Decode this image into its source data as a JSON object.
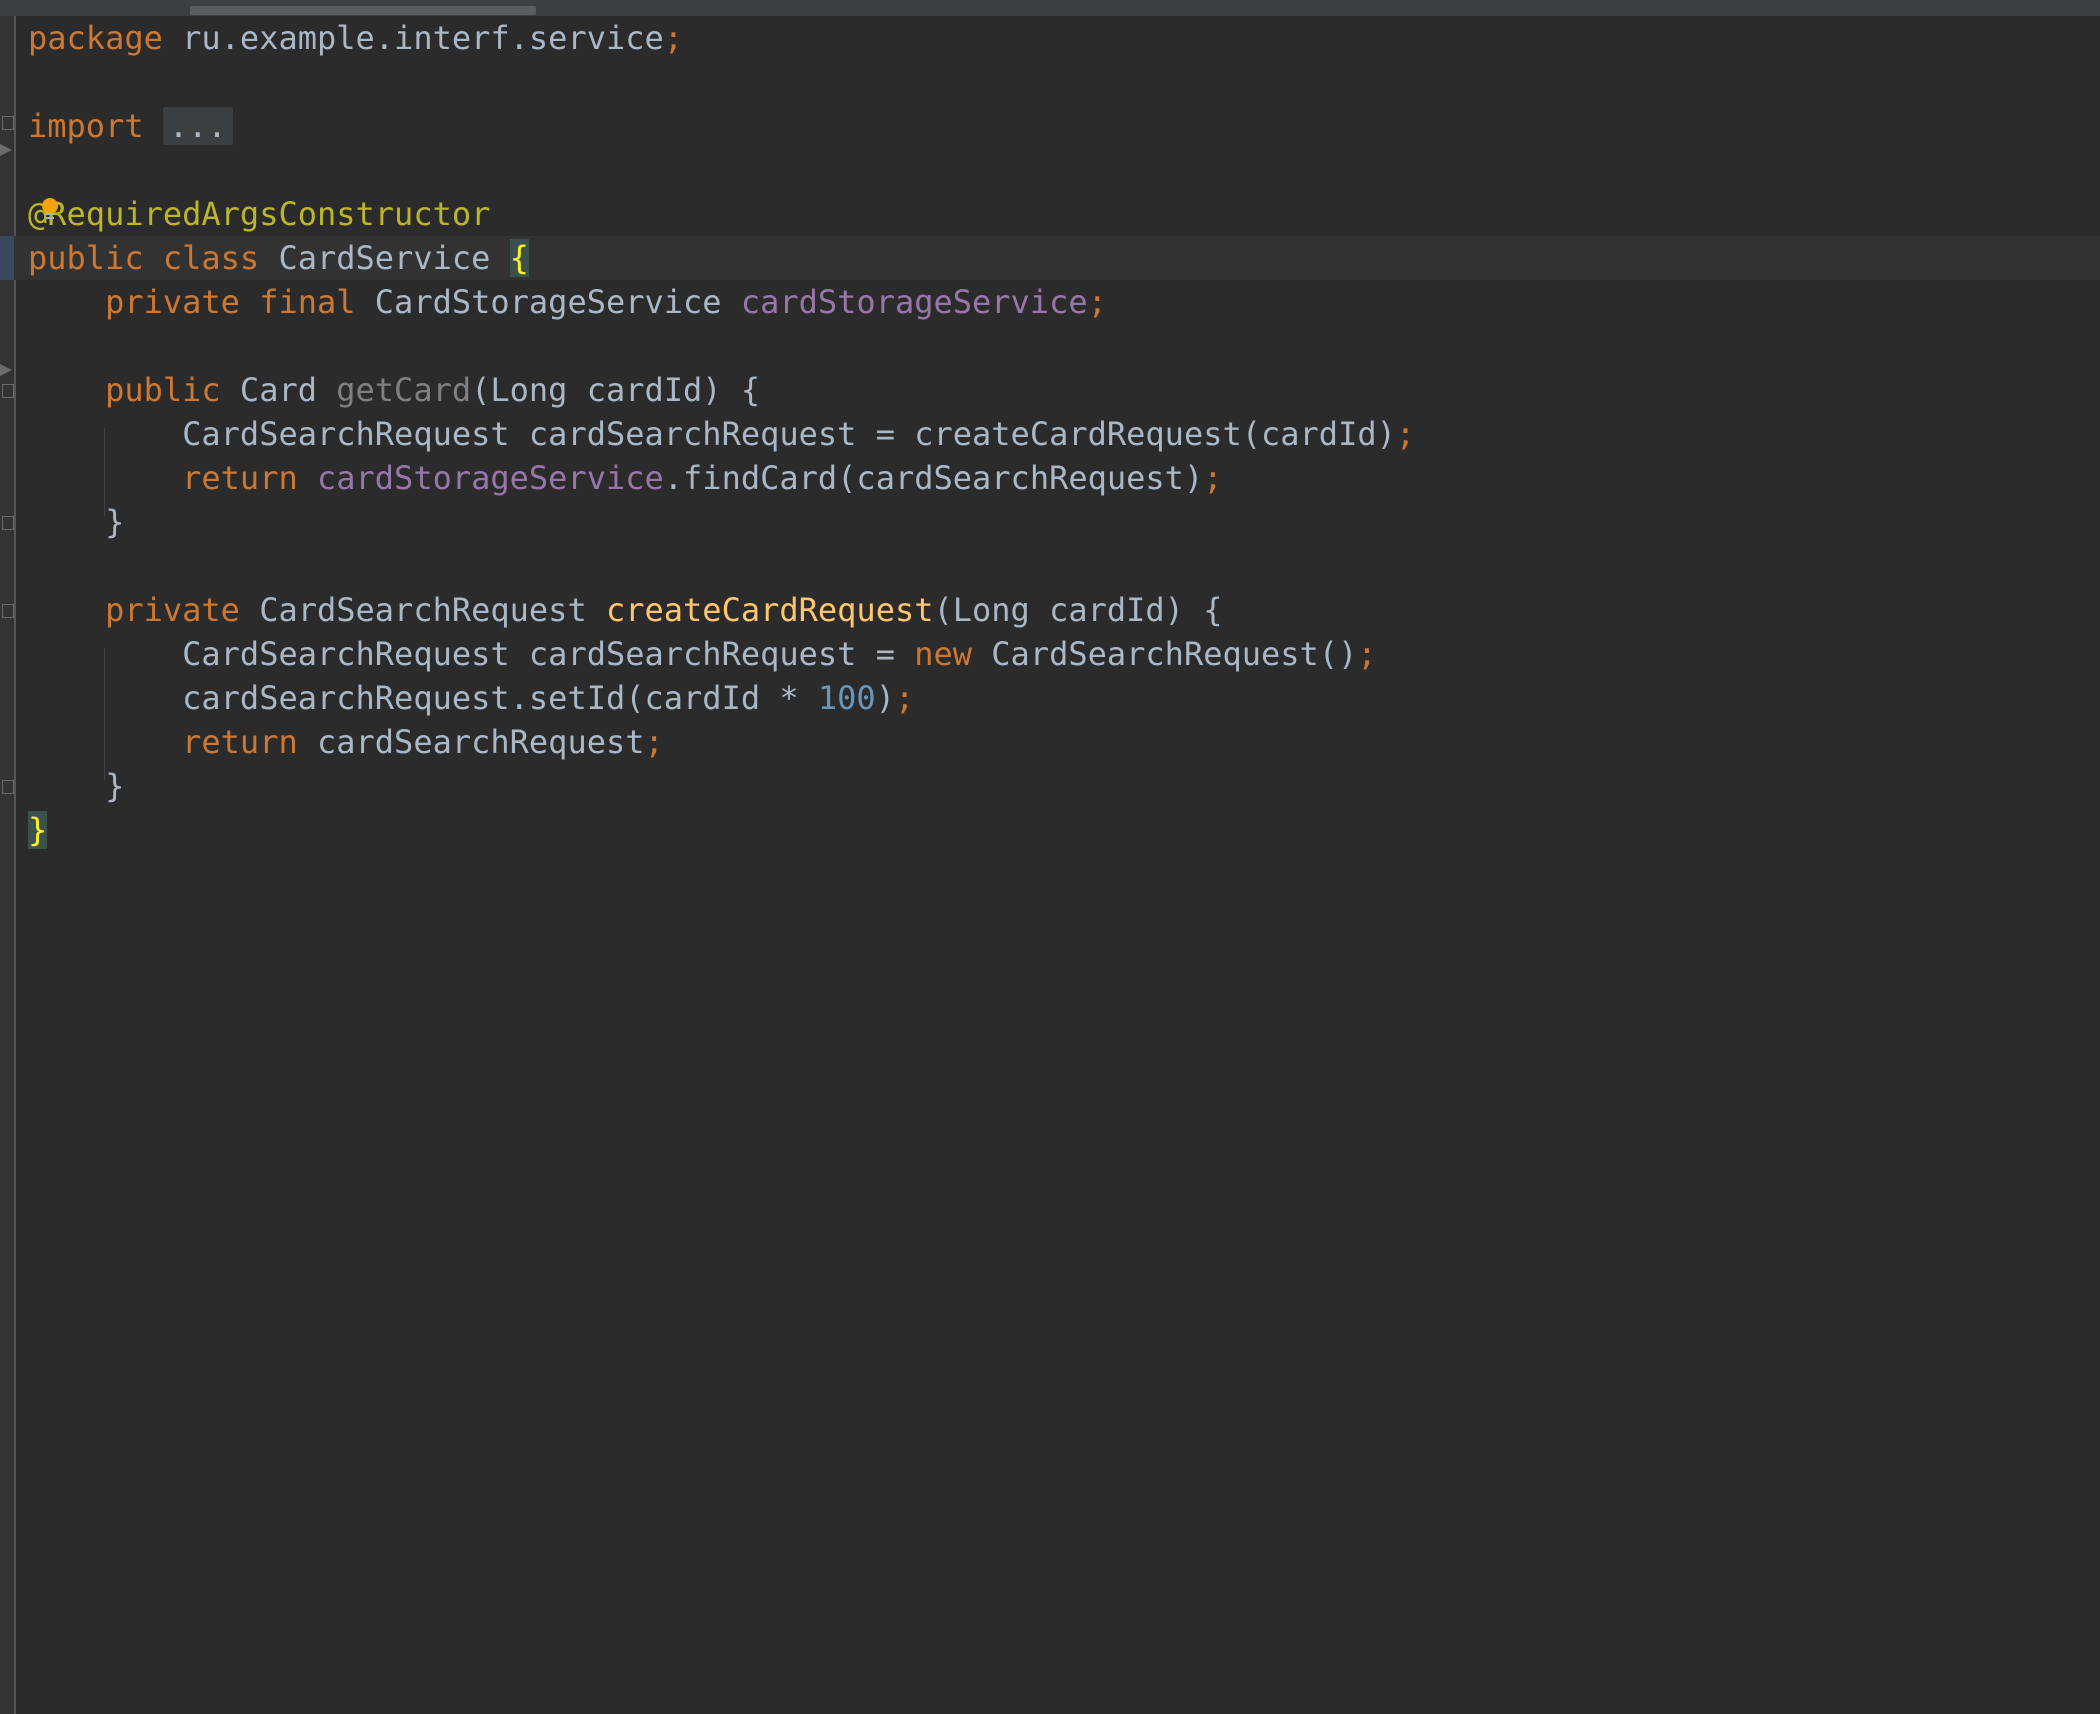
{
  "editor": {
    "lines": [
      {
        "tokens": [
          {
            "t": "package",
            "c": "kw"
          },
          {
            "t": " ru.example.interf.service"
          },
          {
            "t": ";",
            "c": "kw"
          }
        ]
      },
      {
        "tokens": []
      },
      {
        "tokens": [
          {
            "t": "import",
            "c": "kw"
          },
          {
            "t": " "
          },
          {
            "t": "...",
            "c": "fold-dots"
          }
        ]
      },
      {
        "tokens": []
      },
      {
        "tokens": [
          {
            "t": "@RequiredArgsConstructor",
            "c": "ann"
          }
        ]
      },
      {
        "tokens": [
          {
            "t": "public class ",
            "c": "kw"
          },
          {
            "t": "CardService "
          },
          {
            "t": "{",
            "c": "brace-hl"
          }
        ],
        "current": true
      },
      {
        "tokens": [
          {
            "t": "    "
          },
          {
            "t": "private final ",
            "c": "kw"
          },
          {
            "t": "CardStorageService "
          },
          {
            "t": "cardStorageService",
            "c": "fld"
          },
          {
            "t": ";",
            "c": "kw"
          }
        ]
      },
      {
        "tokens": []
      },
      {
        "tokens": [
          {
            "t": "    "
          },
          {
            "t": "public ",
            "c": "kw"
          },
          {
            "t": "Card "
          },
          {
            "t": "getCard",
            "c": "unused"
          },
          {
            "t": "(Long cardId) {"
          }
        ]
      },
      {
        "tokens": [
          {
            "t": "        CardSearchRequest cardSearchRequest = createCardRequest(cardId)"
          },
          {
            "t": ";",
            "c": "kw"
          }
        ]
      },
      {
        "tokens": [
          {
            "t": "        "
          },
          {
            "t": "return ",
            "c": "kw"
          },
          {
            "t": "cardStorageService",
            "c": "fld"
          },
          {
            "t": ".findCard(cardSearchRequest)"
          },
          {
            "t": ";",
            "c": "kw"
          }
        ]
      },
      {
        "tokens": [
          {
            "t": "    }"
          }
        ]
      },
      {
        "tokens": []
      },
      {
        "tokens": [
          {
            "t": "    "
          },
          {
            "t": "private ",
            "c": "kw"
          },
          {
            "t": "CardSearchRequest "
          },
          {
            "t": "createCardRequest",
            "c": "decl"
          },
          {
            "t": "(Long cardId) {"
          }
        ]
      },
      {
        "tokens": [
          {
            "t": "        CardSearchRequest cardSearchRequest = "
          },
          {
            "t": "new ",
            "c": "kw"
          },
          {
            "t": "CardSearchRequest()"
          },
          {
            "t": ";",
            "c": "kw"
          }
        ]
      },
      {
        "tokens": [
          {
            "t": "        cardSearchRequest.setId(cardId * "
          },
          {
            "t": "100",
            "c": "num"
          },
          {
            "t": ")"
          },
          {
            "t": ";",
            "c": "kw"
          }
        ]
      },
      {
        "tokens": [
          {
            "t": "        "
          },
          {
            "t": "return ",
            "c": "kw"
          },
          {
            "t": "cardSearchRequest"
          },
          {
            "t": ";",
            "c": "kw"
          }
        ]
      },
      {
        "tokens": [
          {
            "t": "    }"
          }
        ]
      },
      {
        "tokens": [
          {
            "t": "}",
            "c": "brace-hl"
          }
        ]
      }
    ]
  },
  "gutter": {
    "fold_icons": [
      "import-fold-expand-icon",
      "getcard-fold-collapse-icon",
      "getcard-fold-end-icon",
      "createcardrequest-fold-collapse-icon",
      "createcardrequest-fold-end-icon"
    ]
  },
  "colors": {
    "background": "#2b2b2b",
    "keyword": "#cc7832",
    "annotation": "#bbb529",
    "field": "#9876aa",
    "unused": "#808080",
    "declaration": "#ffc66d",
    "number": "#6897bb",
    "text": "#a9b7c6",
    "intention_bulb": "#f0a30a"
  }
}
